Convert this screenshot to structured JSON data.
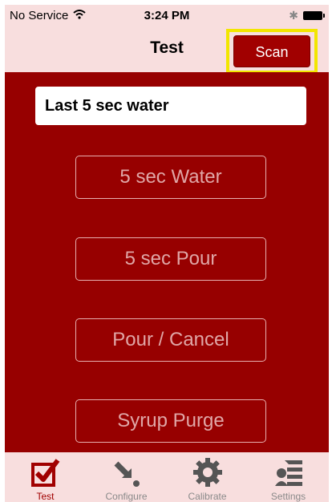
{
  "status_bar": {
    "carrier": "No Service",
    "time": "3:24 PM"
  },
  "nav": {
    "title": "Test",
    "scan_label": "Scan"
  },
  "main": {
    "last_action": "Last 5 sec water",
    "buttons": [
      "5 sec Water",
      "5 sec Pour",
      "Pour / Cancel",
      "Syrup Purge"
    ]
  },
  "tabs": [
    {
      "label": "Test",
      "icon": "checkbox-check-icon",
      "active": true
    },
    {
      "label": "Configure",
      "icon": "arrow-dot-icon",
      "active": false
    },
    {
      "label": "Calibrate",
      "icon": "gear-icon",
      "active": false
    },
    {
      "label": "Settings",
      "icon": "settings-list-icon",
      "active": false
    }
  ],
  "colors": {
    "accent": "#970000",
    "bar_background": "#f8dede",
    "highlight": "#f2e600"
  }
}
